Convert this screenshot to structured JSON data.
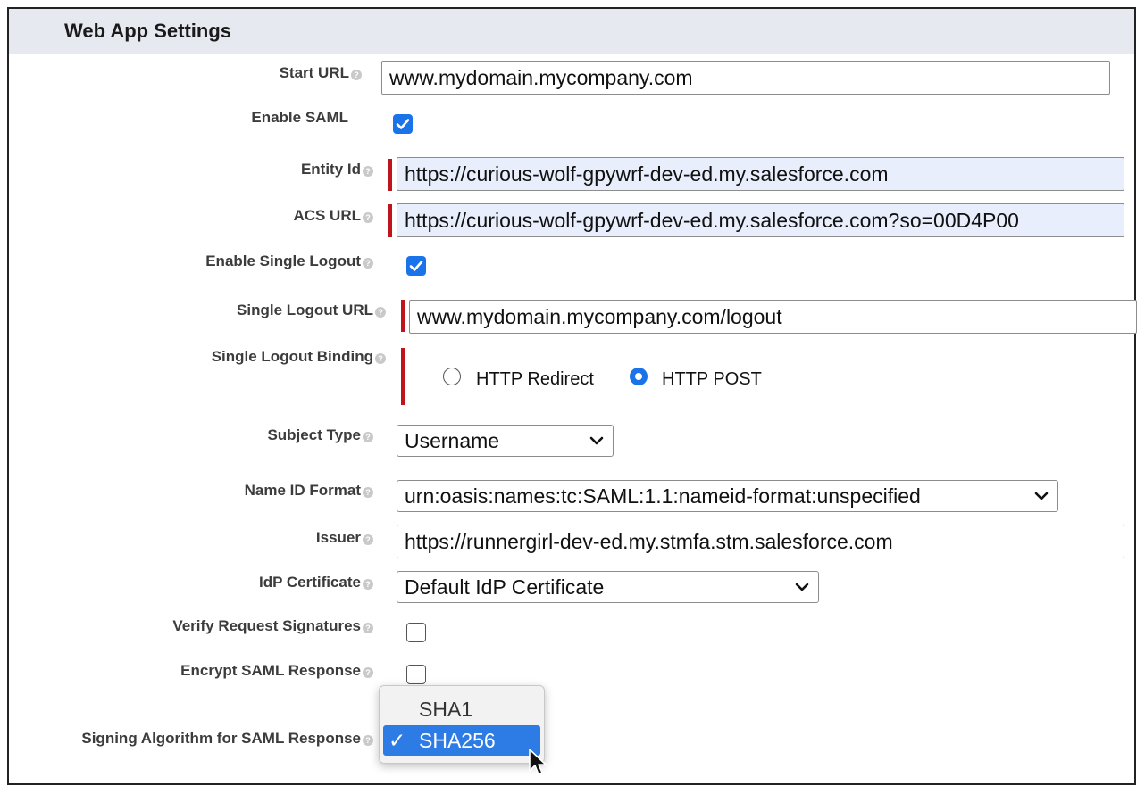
{
  "section": {
    "title": "Web App Settings"
  },
  "fields": {
    "start_url": {
      "label": "Start URL",
      "value": "www.mydomain.mycompany.com"
    },
    "enable_saml": {
      "label": "Enable SAML",
      "checked": true
    },
    "entity_id": {
      "label": "Entity Id",
      "value": "https://curious-wolf-gpywrf-dev-ed.my.salesforce.com"
    },
    "acs_url": {
      "label": "ACS URL",
      "value": "https://curious-wolf-gpywrf-dev-ed.my.salesforce.com?so=00D4P00"
    },
    "enable_single_logout": {
      "label": "Enable Single Logout",
      "checked": true
    },
    "single_logout_url": {
      "label": "Single Logout URL",
      "value": "www.mydomain.mycompany.com/logout"
    },
    "single_logout_binding": {
      "label": "Single Logout Binding",
      "options": [
        "HTTP Redirect",
        "HTTP POST"
      ],
      "selected": "HTTP POST"
    },
    "subject_type": {
      "label": "Subject Type",
      "value": "Username"
    },
    "name_id_format": {
      "label": "Name ID Format",
      "value": "urn:oasis:names:tc:SAML:1.1:nameid-format:unspecified"
    },
    "issuer": {
      "label": "Issuer",
      "value": "https://runnergirl-dev-ed.my.stmfa.stm.salesforce.com"
    },
    "idp_certificate": {
      "label": "IdP Certificate",
      "value": "Default IdP Certificate"
    },
    "verify_request_signatures": {
      "label": "Verify Request Signatures",
      "checked": false
    },
    "encrypt_saml_response": {
      "label": "Encrypt SAML Response",
      "checked": false
    },
    "signing_algorithm": {
      "label": "Signing Algorithm for SAML Response",
      "options": [
        "SHA1",
        "SHA256"
      ],
      "selected": "SHA256"
    }
  },
  "icons": {
    "help": "help-icon",
    "check": "checkmark-icon",
    "chevron": "chevron-down-icon",
    "cursor": "mouse-pointer-icon"
  },
  "colors": {
    "accent": "#1a73e8",
    "required": "#c0141c",
    "header_bg": "#e6e9f0",
    "autofill_bg": "#e8eefc",
    "menu_highlight": "#2d7be5"
  }
}
